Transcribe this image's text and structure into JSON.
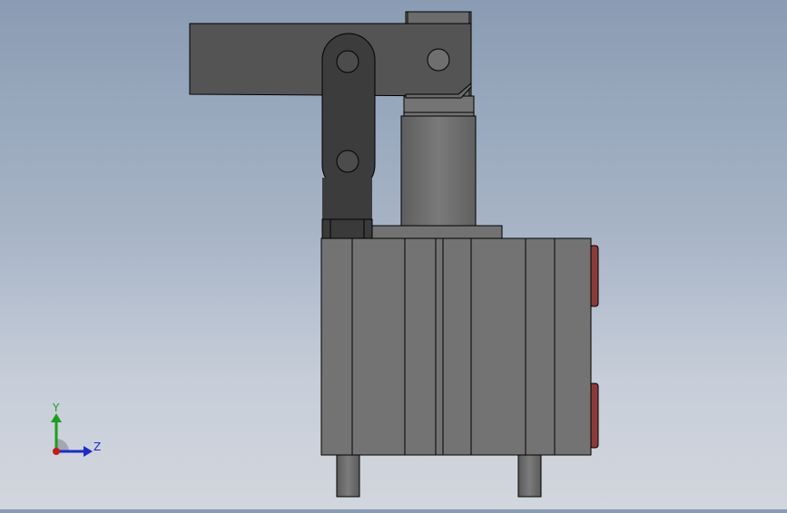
{
  "viewport": {
    "background_top": "#8a9cb3",
    "background_bottom": "#d2d6dd"
  },
  "model": {
    "body_color": "#737373",
    "arm_color": "#545454",
    "link_color": "#3c3c3c",
    "cylinder_color": "#6d6d6d",
    "port_color": "#8b3a3a",
    "edge_color": "#000000"
  },
  "triad": {
    "y_label": "Y",
    "z_label": "Z",
    "y_color": "#1aa01a",
    "z_color": "#1a2cc8",
    "origin_color": "#c81a1a"
  }
}
